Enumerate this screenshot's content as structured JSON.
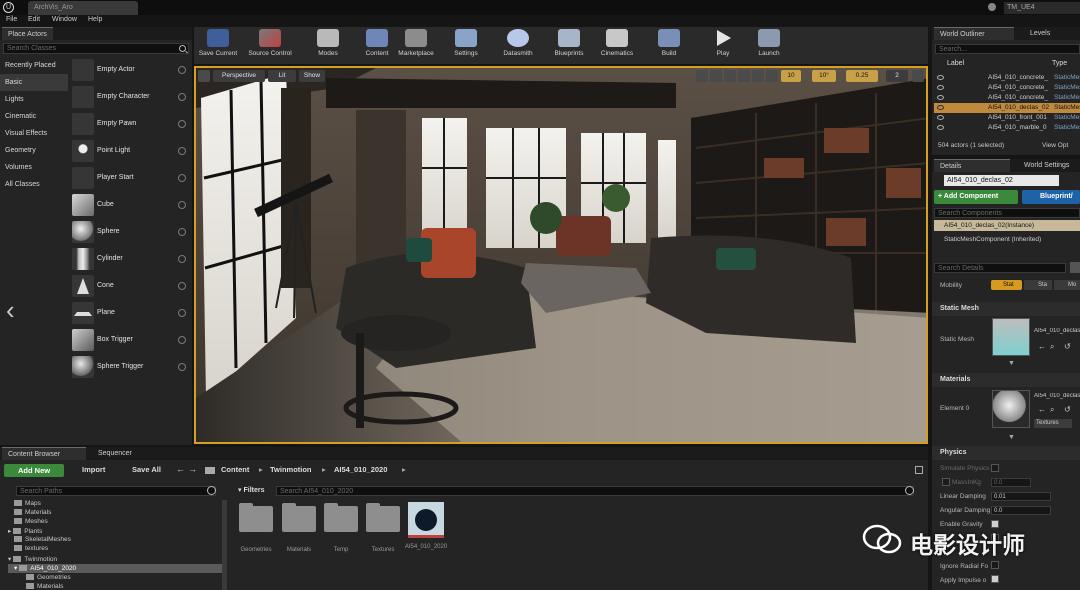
{
  "window": {
    "logo": "U",
    "doc_tab": "ArchVis_Aro",
    "project": "TM_UE4",
    "menu": [
      "File",
      "Edit",
      "Window",
      "Help"
    ]
  },
  "place_actors": {
    "tab": "Place Actors",
    "search_placeholder": "Search Classes",
    "categories": [
      "Recently Placed",
      "Basic",
      "Lights",
      "Cinematic",
      "Visual Effects",
      "Geometry",
      "Volumes",
      "All Classes"
    ],
    "actors": [
      "Empty Actor",
      "Empty Character",
      "Empty Pawn",
      "Point Light",
      "Player Start",
      "Cube",
      "Sphere",
      "Cylinder",
      "Cone",
      "Plane",
      "Box Trigger",
      "Sphere Trigger"
    ]
  },
  "toolbar": {
    "buttons": [
      "Save Current",
      "Source Control",
      "Modes",
      "Content",
      "Marketplace",
      "Settings",
      "Datasmith",
      "Blueprints",
      "Cinematics",
      "Build",
      "Play",
      "Launch"
    ]
  },
  "viewport": {
    "perspective": "Perspective",
    "lit": "Lit",
    "show": "Show",
    "grid_snap": "10",
    "rot_snap": "10°",
    "scale_snap": "0.25",
    "cam_speed": "2"
  },
  "outliner": {
    "tabs": [
      "World Outliner",
      "Levels"
    ],
    "search_placeholder": "Search...",
    "col_label": "Label",
    "col_type": "Type",
    "rows": [
      {
        "label": "AI54_010_concrete_",
        "type": "StaticMes"
      },
      {
        "label": "AI54_010_concrete_",
        "type": "StaticMes"
      },
      {
        "label": "AI54_010_concrete_",
        "type": "StaticMes"
      },
      {
        "label": "AI54_010_declas_02",
        "type": "StaticMes"
      },
      {
        "label": "AI54_010_front_001",
        "type": "StaticMes"
      },
      {
        "label": "AI54_010_marble_0",
        "type": "StaticMes"
      }
    ],
    "count": "504 actors (1 selected)",
    "view_options": "View Opt"
  },
  "details": {
    "tabs": [
      "Details",
      "World Settings"
    ],
    "name": "AI54_010_declas_02",
    "add_component": "+ Add Component",
    "blueprint": "Blueprint/",
    "search_components": "Search Components",
    "instance": "AI54_010_declas_02(Instance)",
    "component": "StaticMeshComponent (Inherited)",
    "search_details": "Search Details",
    "mobility_label": "Mobility",
    "mobility_options": [
      "Stat",
      "Sta",
      "Mo"
    ],
    "static_mesh_header": "Static Mesh",
    "static_mesh_label": "Static Mesh",
    "static_mesh_value": "AI54_010_declas",
    "materials_header": "Materials",
    "element_label": "Element 0",
    "element_value": "AI54_010_declas",
    "textures": "Textures",
    "physics_header": "Physics",
    "physics": [
      {
        "label": "Simulate Physics",
        "kind": "check",
        "on": false
      },
      {
        "label": "MassInKg",
        "kind": "value",
        "value": "0.0"
      },
      {
        "label": "Linear Damping",
        "kind": "value",
        "value": "0.01"
      },
      {
        "label": "Angular Damping",
        "kind": "value",
        "value": "0.0"
      },
      {
        "label": "Enable Gravity",
        "kind": "check",
        "on": true
      },
      {
        "label": "",
        "kind": "check",
        "on": false
      },
      {
        "label": "Ignore Radial Fo",
        "kind": "check",
        "on": false
      },
      {
        "label": "Apply Impulse o",
        "kind": "check",
        "on": true
      }
    ]
  },
  "content_browser": {
    "tabs": [
      "Content Browser",
      "Sequencer"
    ],
    "add_new": "Add New",
    "import": "Import",
    "save_all": "Save All",
    "path": [
      "Content",
      "Twinmotion",
      "AI54_010_2020"
    ],
    "search_paths": "Search Paths",
    "filters": "Filters",
    "search_assets": "Search AI54_010_2020",
    "tree": [
      "Maps",
      "Materials",
      "Meshes",
      "Plants",
      "SkeletalMeshes",
      "textures",
      "Twinmotion",
      "AI54_010_2020",
      "Geometries",
      "Materials"
    ],
    "assets": [
      "Geometries",
      "Materials",
      "Temp",
      "Textures",
      "AI54_010_2020"
    ]
  },
  "watermark": "电影设计师"
}
